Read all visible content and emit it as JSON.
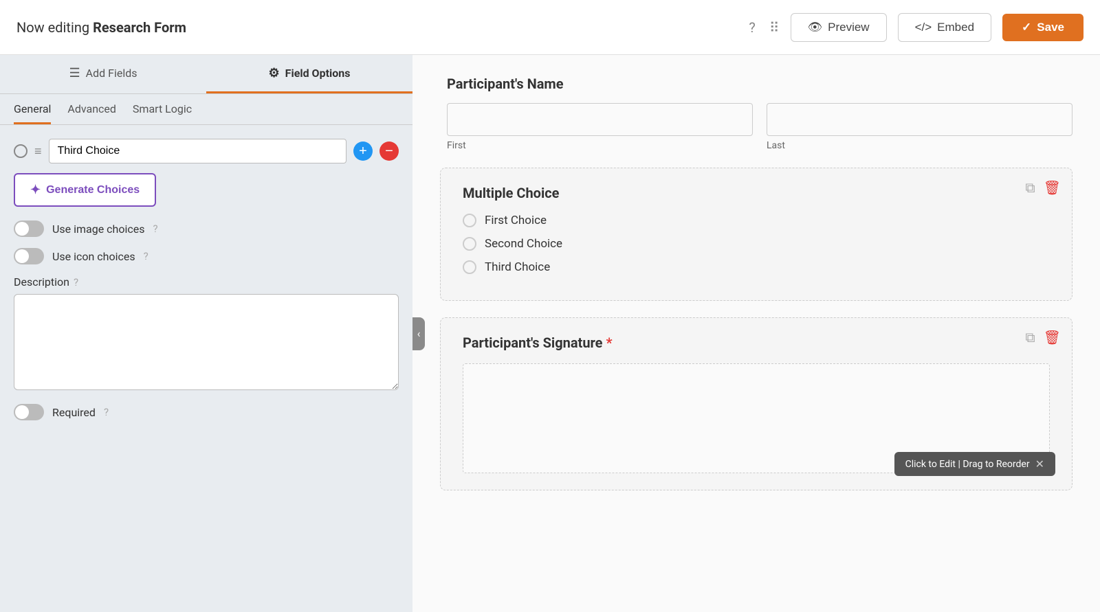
{
  "header": {
    "title_prefix": "Now editing ",
    "title_bold": "Research Form",
    "help_icon": "?",
    "grid_icon": "⠿",
    "preview_label": "Preview",
    "embed_label": "Embed",
    "save_label": "Save"
  },
  "left_panel": {
    "tab_add_fields": "Add Fields",
    "tab_field_options": "Field Options",
    "sub_tabs": [
      "General",
      "Advanced",
      "Smart Logic"
    ],
    "active_sub_tab": "General",
    "choice_input_value": "Third Choice",
    "generate_btn": "Generate Choices",
    "toggle_image": {
      "label": "Use image choices",
      "on": false
    },
    "toggle_icon": {
      "label": "Use icon choices",
      "on": false
    },
    "description_label": "Description",
    "required_label": "Required",
    "required_on": false
  },
  "right_panel": {
    "participant_name_heading": "Participant's Name",
    "first_label": "First",
    "last_label": "Last",
    "multiple_choice_title": "Multiple Choice",
    "choices": [
      "First Choice",
      "Second Choice",
      "Third Choice"
    ],
    "signature_title": "Participant's Signature",
    "signature_required": true,
    "tooltip_text": "Click to Edit | Drag to Reorder"
  }
}
